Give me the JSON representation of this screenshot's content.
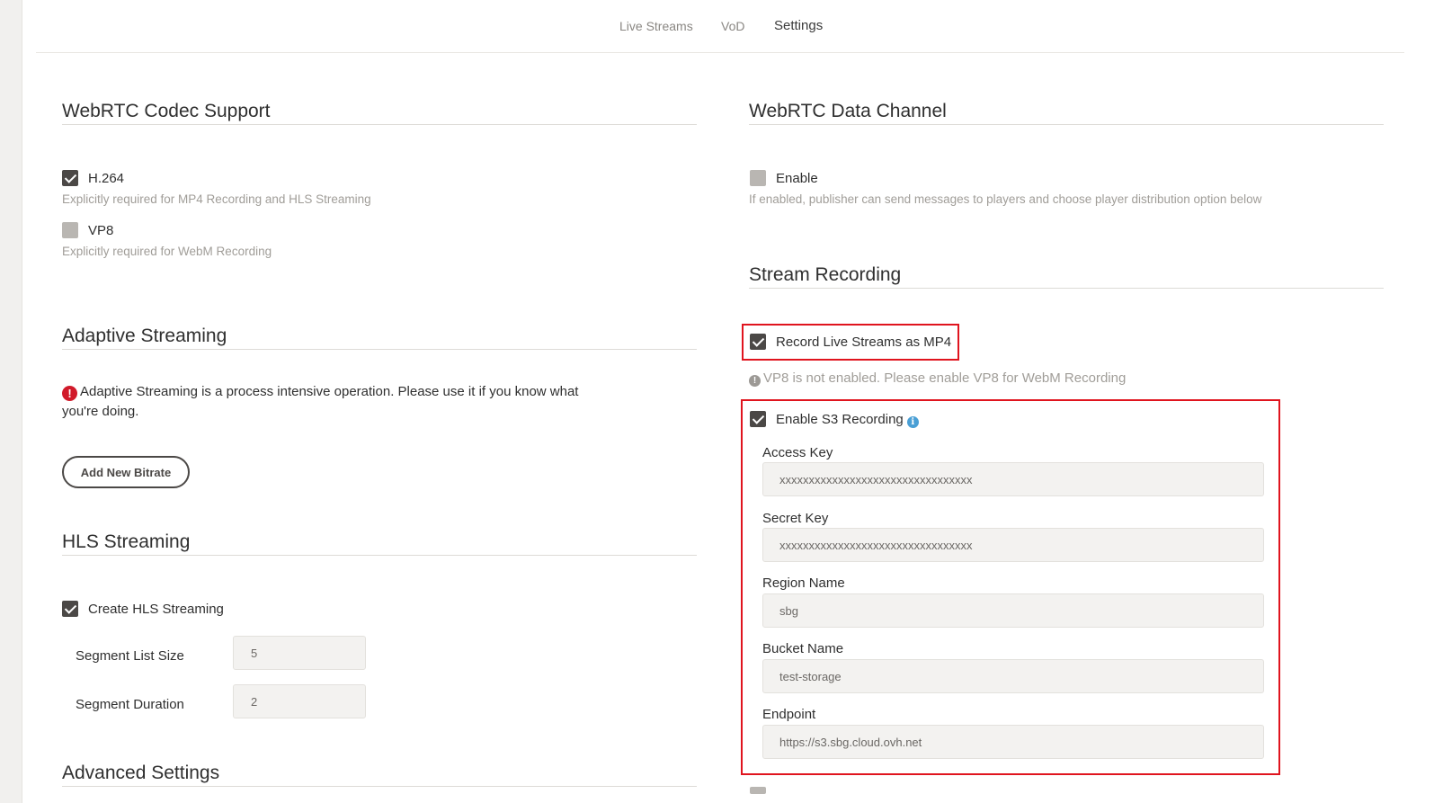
{
  "nav": {
    "items": [
      {
        "label": "Live Streams"
      },
      {
        "label": "VoD"
      },
      {
        "label": "Settings"
      }
    ]
  },
  "codec": {
    "title": "WebRTC Codec Support",
    "h264": {
      "label": "H.264",
      "hint": "Explicitly required for MP4 Recording and HLS Streaming",
      "checked": true
    },
    "vp8": {
      "label": "VP8",
      "hint": "Explicitly required for WebM Recording",
      "checked": false
    }
  },
  "adaptive": {
    "title": "Adaptive Streaming",
    "warning": "Adaptive Streaming is a process intensive operation. Please use it if you know what you're doing.",
    "button": "Add New Bitrate"
  },
  "hls": {
    "title": "HLS Streaming",
    "create": {
      "label": "Create HLS Streaming",
      "checked": true
    },
    "segment_list_size": {
      "label": "Segment List Size",
      "value": "5"
    },
    "segment_duration": {
      "label": "Segment Duration",
      "value": "2"
    }
  },
  "advanced": {
    "title": "Advanced Settings"
  },
  "datachannel": {
    "title": "WebRTC Data Channel",
    "enable": {
      "label": "Enable",
      "hint": "If enabled, publisher can send messages to players and choose player distribution option below",
      "checked": false
    }
  },
  "recording": {
    "title": "Stream Recording",
    "mp4": {
      "label": "Record Live Streams as MP4",
      "checked": true
    },
    "vp8_notice": "VP8 is not enabled. Please enable VP8 for WebM Recording",
    "s3": {
      "label": "Enable S3 Recording",
      "checked": true,
      "access_key": {
        "label": "Access Key",
        "value": "xxxxxxxxxxxxxxxxxxxxxxxxxxxxxxxxx"
      },
      "secret_key": {
        "label": "Secret Key",
        "value": "xxxxxxxxxxxxxxxxxxxxxxxxxxxxxxxxx"
      },
      "region": {
        "label": "Region Name",
        "value": "sbg"
      },
      "bucket": {
        "label": "Bucket Name",
        "value": "test-storage"
      },
      "endpoint": {
        "label": "Endpoint",
        "value": "https://s3.sbg.cloud.ovh.net"
      }
    }
  },
  "colors": {
    "highlight": "#e0141e",
    "checkbox": "#4b4846",
    "warning": "#d11a2a",
    "info": "#4a9fd5"
  }
}
